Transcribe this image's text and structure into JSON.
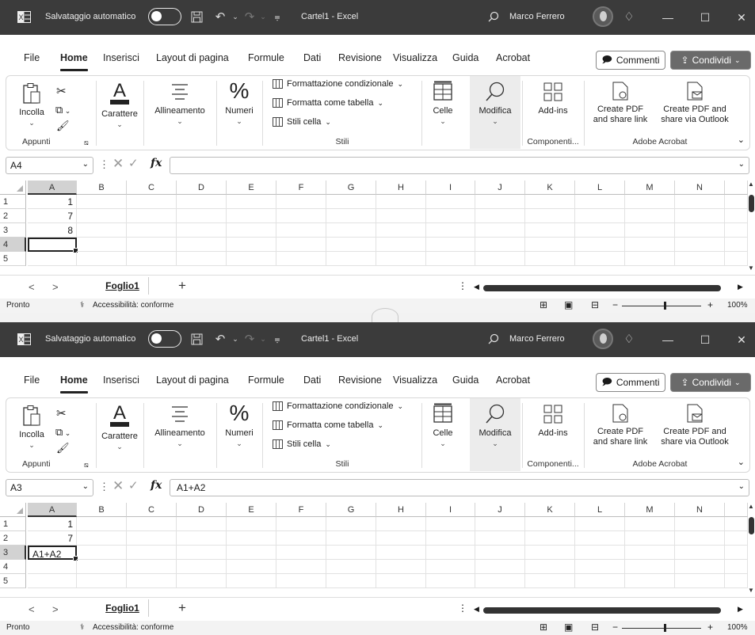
{
  "windows": [
    {
      "titlebar": {
        "autosave_label": "Salvataggio automatico",
        "doc_title": "Cartel1 - Excel",
        "user_name": "Marco Ferrero"
      },
      "menu": [
        "File",
        "Home",
        "Inserisci",
        "Layout di pagina",
        "Formule",
        "Dati",
        "Revisione",
        "Visualizza",
        "Guida",
        "Acrobat"
      ],
      "active_tab": "Home",
      "comments_label": "Commenti",
      "share_label": "Condividi",
      "ribbon": {
        "paste": "Incolla",
        "clipboard_group": "Appunti",
        "font": "Carattere",
        "alignment": "Allineamento",
        "number": "Numeri",
        "cond_format": "Formattazione condizionale",
        "format_table": "Formatta come tabella",
        "cell_styles": "Stili cella",
        "styles_group": "Stili",
        "cells": "Celle",
        "editing": "Modifica",
        "addins": "Add-ins",
        "addins_group": "Componenti...",
        "create_pdf_1": "Create PDF",
        "create_pdf_2": "and share link",
        "create_pdf_outlook_1": "Create PDF and",
        "create_pdf_outlook_2": "share via Outlook",
        "acrobat_group": "Adobe Acrobat"
      },
      "name_box": "A4",
      "formula": "",
      "columns": [
        "A",
        "B",
        "C",
        "D",
        "E",
        "F",
        "G",
        "H",
        "I",
        "J",
        "K",
        "L",
        "M",
        "N"
      ],
      "selected_column": "A",
      "rows": [
        "1",
        "2",
        "3",
        "4",
        "5"
      ],
      "selected_row": "4",
      "cells_a": [
        "1",
        "7",
        "8",
        "",
        ""
      ],
      "numeric_a": [
        true,
        true,
        true,
        false,
        false
      ],
      "selected_cell_row": 3,
      "sheet_tab": "Foglio1",
      "status_ready": "Pronto",
      "status_access": "Accessibilità: conforme",
      "zoom": "100%"
    },
    {
      "titlebar": {
        "autosave_label": "Salvataggio automatico",
        "doc_title": "Cartel1 - Excel",
        "user_name": "Marco Ferrero"
      },
      "menu": [
        "File",
        "Home",
        "Inserisci",
        "Layout di pagina",
        "Formule",
        "Dati",
        "Revisione",
        "Visualizza",
        "Guida",
        "Acrobat"
      ],
      "active_tab": "Home",
      "comments_label": "Commenti",
      "share_label": "Condividi",
      "ribbon": {
        "paste": "Incolla",
        "clipboard_group": "Appunti",
        "font": "Carattere",
        "alignment": "Allineamento",
        "number": "Numeri",
        "cond_format": "Formattazione condizionale",
        "format_table": "Formatta come tabella",
        "cell_styles": "Stili cella",
        "styles_group": "Stili",
        "cells": "Celle",
        "editing": "Modifica",
        "addins": "Add-ins",
        "addins_group": "Componenti...",
        "create_pdf_1": "Create PDF",
        "create_pdf_2": "and share link",
        "create_pdf_outlook_1": "Create PDF and",
        "create_pdf_outlook_2": "share via Outlook",
        "acrobat_group": "Adobe Acrobat"
      },
      "name_box": "A3",
      "formula": "A1+A2",
      "columns": [
        "A",
        "B",
        "C",
        "D",
        "E",
        "F",
        "G",
        "H",
        "I",
        "J",
        "K",
        "L",
        "M",
        "N"
      ],
      "selected_column": "A",
      "rows": [
        "1",
        "2",
        "3",
        "4",
        "5"
      ],
      "selected_row": "3",
      "cells_a": [
        "1",
        "7",
        "A1+A2",
        "",
        ""
      ],
      "numeric_a": [
        true,
        true,
        false,
        false,
        false
      ],
      "selected_cell_row": 2,
      "sheet_tab": "Foglio1",
      "status_ready": "Pronto",
      "status_access": "Accessibilità: conforme",
      "zoom": "100%"
    }
  ]
}
